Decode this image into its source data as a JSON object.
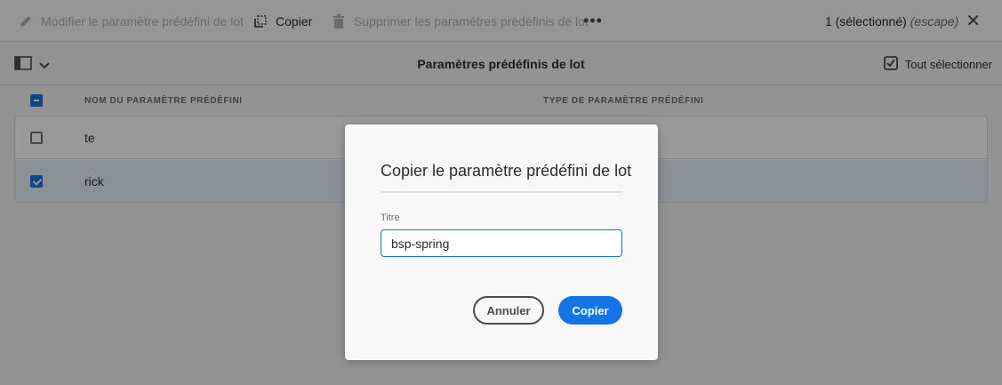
{
  "actionbar": {
    "edit_label": "Modifier le paramètre prédéfini de lot",
    "copy_label": "Copier",
    "delete_label": "Supprimer les paramètres prédéfinis de lot",
    "more_label": "•••",
    "selection_count": "1 (sélectionné)",
    "escape_hint": "(escape)",
    "close_glyph": "✕"
  },
  "titlebar": {
    "title": "Paramètres prédéfinis de lot",
    "select_all_label": "Tout sélectionner"
  },
  "table": {
    "columns": [
      "NOM DU PARAMÈTRE PRÉDÉFINI",
      "TYPE DE PARAMÈTRE PRÉDÉFINI"
    ],
    "rows": [
      {
        "name": "te",
        "selected": false
      },
      {
        "name": "rick",
        "selected": true
      }
    ]
  },
  "dialog": {
    "title": "Copier le paramètre prédéfini de lot",
    "field_label": "Titre",
    "field_value": "bsp-spring",
    "cancel_label": "Annuler",
    "confirm_label": "Copier"
  },
  "icons": [
    "pencil-icon",
    "copy-icon",
    "trash-icon",
    "more-icon",
    "close-icon",
    "rail-icon",
    "chevron-down-icon",
    "checkbox-icon"
  ],
  "colors": {
    "accent": "#1473e6",
    "overlay": "rgba(0,0,0,0.4)",
    "selected_row": "#e8f0fb"
  }
}
